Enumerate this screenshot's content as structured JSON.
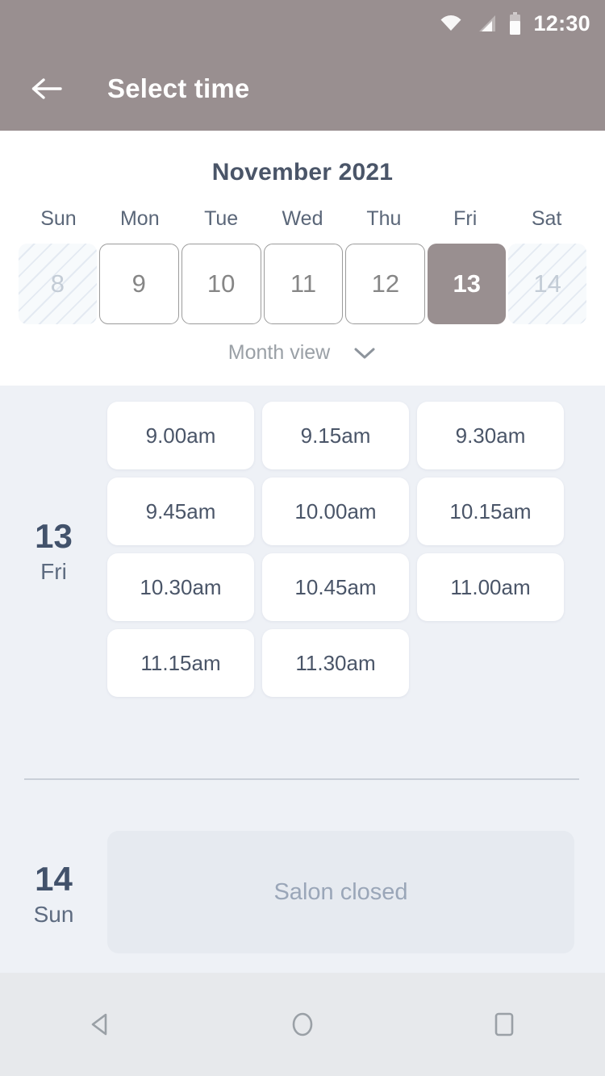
{
  "status_bar": {
    "time": "12:30",
    "icons": [
      "wifi-icon",
      "signal-icon",
      "battery-icon"
    ]
  },
  "app_bar": {
    "back_icon": "back-arrow-icon",
    "title": "Select time"
  },
  "calendar": {
    "month_title": "November 2021",
    "weekday_labels": [
      "Sun",
      "Mon",
      "Tue",
      "Wed",
      "Thu",
      "Fri",
      "Sat"
    ],
    "days": [
      {
        "number": "8",
        "state": "disabled"
      },
      {
        "number": "9",
        "state": "enabled"
      },
      {
        "number": "10",
        "state": "enabled"
      },
      {
        "number": "11",
        "state": "enabled"
      },
      {
        "number": "12",
        "state": "enabled"
      },
      {
        "number": "13",
        "state": "selected"
      },
      {
        "number": "14",
        "state": "disabled"
      }
    ],
    "view_toggle": {
      "label": "Month view",
      "icon": "chevron-down-icon"
    }
  },
  "schedule": {
    "groups": [
      {
        "day_number": "13",
        "day_of_week": "Fri",
        "slots": [
          "9.00am",
          "9.15am",
          "9.30am",
          "9.45am",
          "10.00am",
          "10.15am",
          "10.30am",
          "10.45am",
          "11.00am",
          "11.15am",
          "11.30am"
        ]
      },
      {
        "day_number": "14",
        "day_of_week": "Sun",
        "closed_message": "Salon closed"
      }
    ]
  },
  "nav_bar": {
    "back": "nav-back-icon",
    "home": "nav-home-icon",
    "recents": "nav-recents-icon"
  },
  "colors": {
    "header": "#998f90",
    "selected_day": "#998f90",
    "page_bg": "#eef1f6",
    "panel_bg": "#ffffff",
    "text_dark": "#4a5568",
    "text_muted": "#9aa6b8"
  }
}
